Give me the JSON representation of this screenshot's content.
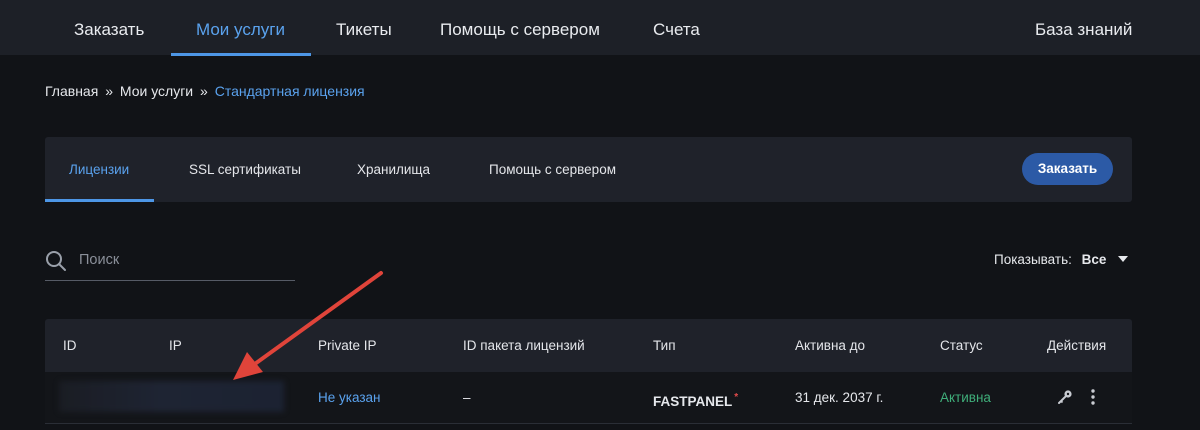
{
  "topnav": {
    "items": [
      "Заказать",
      "Мои услуги",
      "Тикеты",
      "Помощь с сервером",
      "Счета"
    ],
    "knowledge_base": "База знаний",
    "active": "Мои услуги"
  },
  "breadcrumb": {
    "home": "Главная",
    "sep": "»",
    "services": "Мои услуги",
    "current": "Стандартная лицензия"
  },
  "tabs": {
    "items": [
      "Лицензии",
      "SSL сертификаты",
      "Хранилища",
      "Помощь с сервером"
    ],
    "active": "Лицензии",
    "order_button": "Заказать"
  },
  "search": {
    "placeholder": "Поиск",
    "icon": "search-icon"
  },
  "show": {
    "label": "Показывать:",
    "value": "Все"
  },
  "table": {
    "headers": [
      "ID",
      "IP",
      "Private IP",
      "ID пакета лицензий",
      "Тип",
      "Активна до",
      "Статус",
      "Действия"
    ],
    "rows": [
      {
        "private_ip": "Не указан",
        "package_id": "–",
        "type": "FASTPANEL",
        "type_mark": "*",
        "active_until": "31 дек. 2037 г.",
        "status": "Активна",
        "actions": [
          "key-icon",
          "more-vertical-icon"
        ]
      }
    ]
  },
  "colors": {
    "accent": "#5aa2ee",
    "button": "#2c5aa6",
    "status_active": "#3fae7a",
    "annotation_arrow": "#e0443a"
  }
}
